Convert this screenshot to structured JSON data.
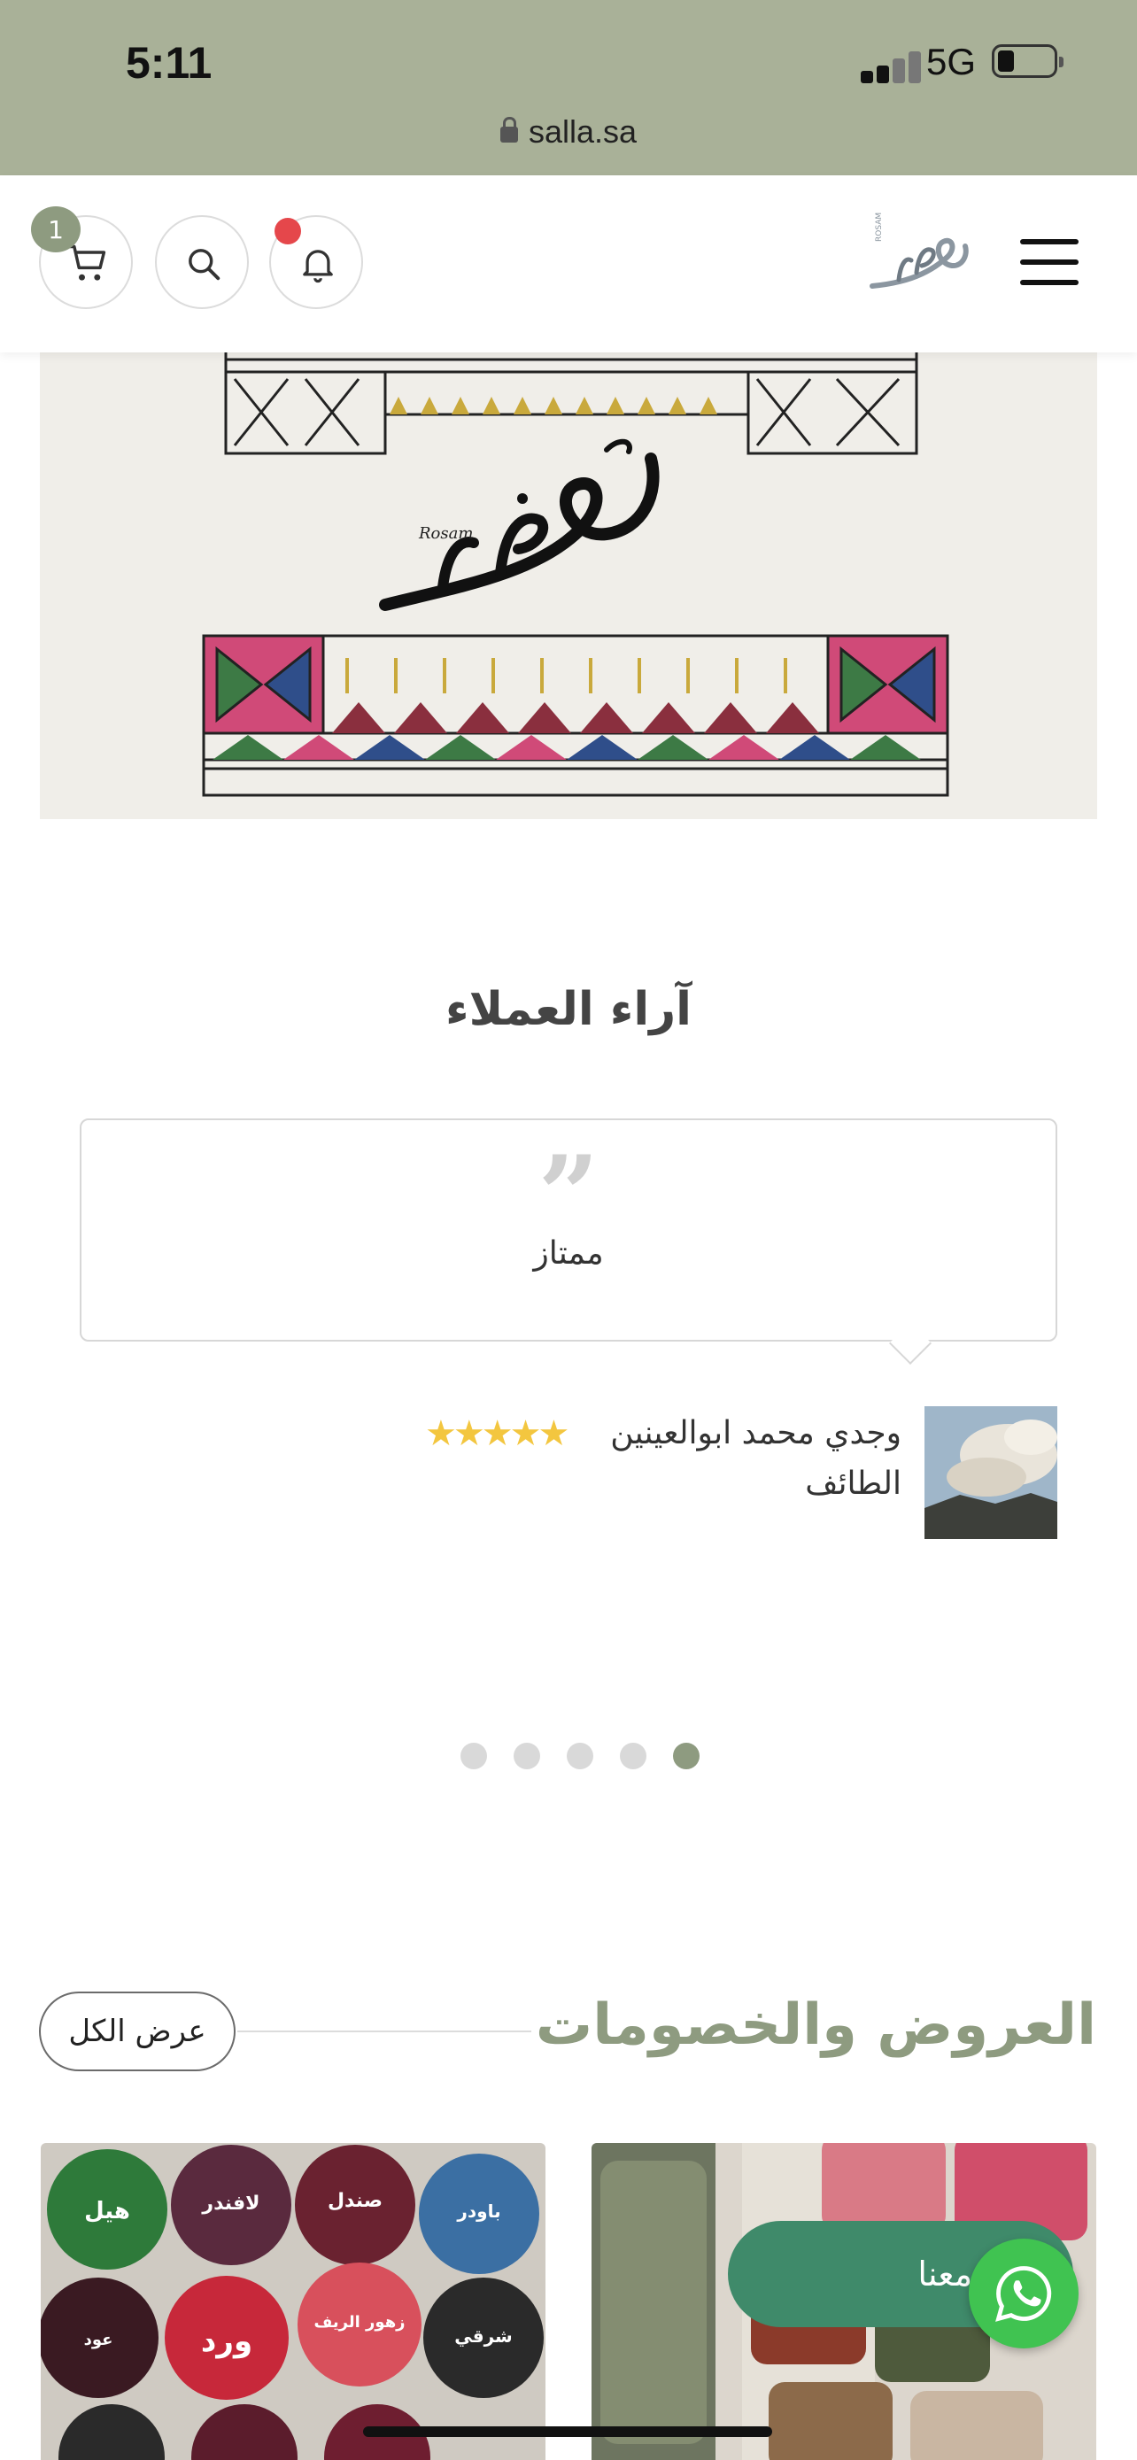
{
  "status_bar": {
    "time": "5:11",
    "network": "5G",
    "url": "salla.sa"
  },
  "header": {
    "cart_count": "1",
    "logo_icon": "rosam-logo",
    "icons": [
      "cart-icon",
      "search-icon",
      "bell-icon",
      "menu-icon"
    ],
    "notification_dot_color": "#e5474b"
  },
  "banner": {
    "brand_arabic": "روزام",
    "brand_latin": "Rosam"
  },
  "testimonials": {
    "title": "آراء العملاء",
    "quote": "ممتاز",
    "reviewer_name": "وجدي محمد ابوالعينين",
    "reviewer_city": "الطائف",
    "rating": 5,
    "rating_stars": "★★★★★",
    "slide_count": 5,
    "active_slide": 5
  },
  "offers": {
    "title": "العروض والخصومات",
    "view_all": "عرض الكل",
    "product_left_labels": [
      "هيل",
      "لافندر",
      "صندل",
      "باودر",
      "عود",
      "ورد",
      "زهور الريف",
      "شرقي"
    ]
  },
  "contact": {
    "label": "تواصل معنا",
    "icon": "whatsapp-icon"
  },
  "colors": {
    "status_bar_bg": "#a9b198",
    "accent": "#8e9b80",
    "whatsapp": "#40c351",
    "contact_pill": "#3f8a6a",
    "stars": "#f3c63f"
  }
}
